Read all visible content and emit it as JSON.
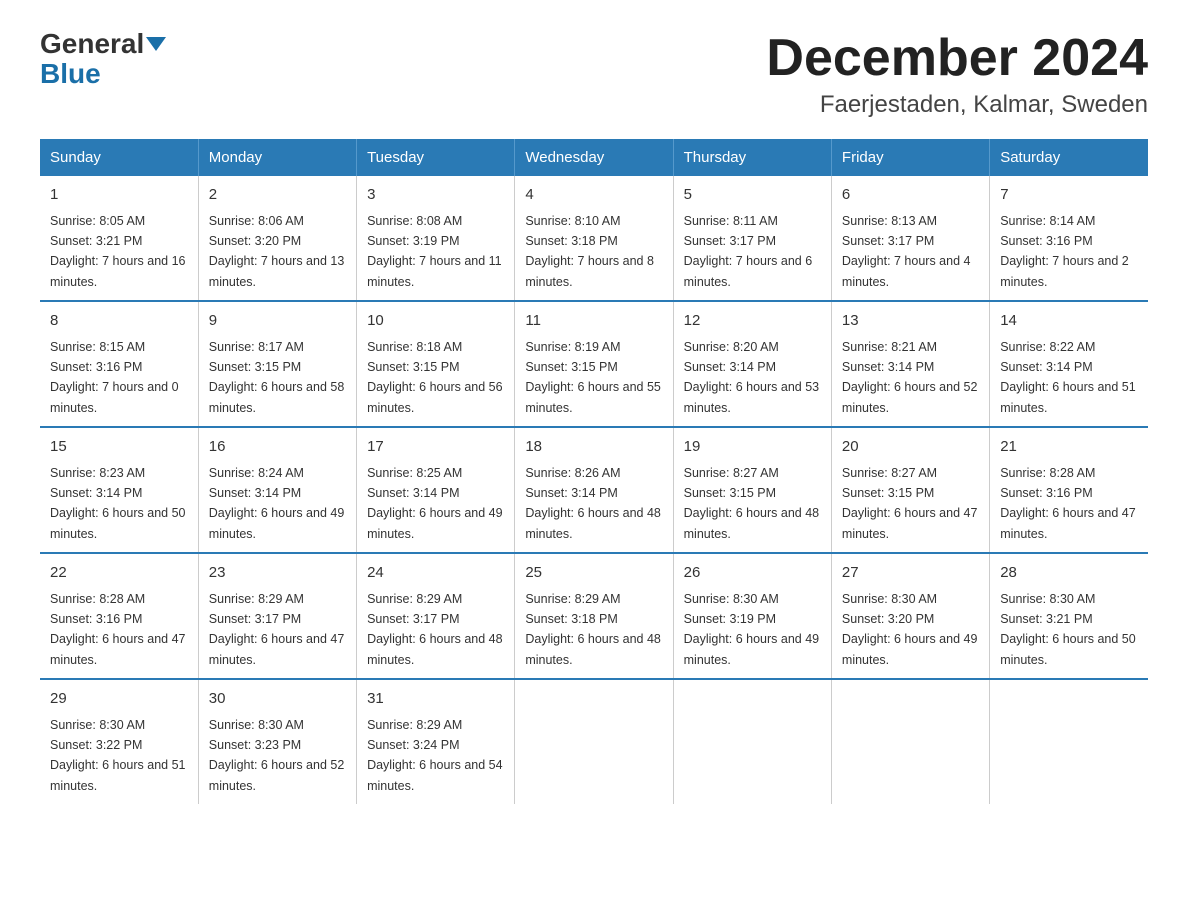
{
  "logo": {
    "top": "General",
    "bottom": "Blue"
  },
  "title": "December 2024",
  "subtitle": "Faerjestaden, Kalmar, Sweden",
  "headers": [
    "Sunday",
    "Monday",
    "Tuesday",
    "Wednesday",
    "Thursday",
    "Friday",
    "Saturday"
  ],
  "weeks": [
    [
      {
        "day": "1",
        "sunrise": "8:05 AM",
        "sunset": "3:21 PM",
        "daylight": "7 hours and 16 minutes."
      },
      {
        "day": "2",
        "sunrise": "8:06 AM",
        "sunset": "3:20 PM",
        "daylight": "7 hours and 13 minutes."
      },
      {
        "day": "3",
        "sunrise": "8:08 AM",
        "sunset": "3:19 PM",
        "daylight": "7 hours and 11 minutes."
      },
      {
        "day": "4",
        "sunrise": "8:10 AM",
        "sunset": "3:18 PM",
        "daylight": "7 hours and 8 minutes."
      },
      {
        "day": "5",
        "sunrise": "8:11 AM",
        "sunset": "3:17 PM",
        "daylight": "7 hours and 6 minutes."
      },
      {
        "day": "6",
        "sunrise": "8:13 AM",
        "sunset": "3:17 PM",
        "daylight": "7 hours and 4 minutes."
      },
      {
        "day": "7",
        "sunrise": "8:14 AM",
        "sunset": "3:16 PM",
        "daylight": "7 hours and 2 minutes."
      }
    ],
    [
      {
        "day": "8",
        "sunrise": "8:15 AM",
        "sunset": "3:16 PM",
        "daylight": "7 hours and 0 minutes."
      },
      {
        "day": "9",
        "sunrise": "8:17 AM",
        "sunset": "3:15 PM",
        "daylight": "6 hours and 58 minutes."
      },
      {
        "day": "10",
        "sunrise": "8:18 AM",
        "sunset": "3:15 PM",
        "daylight": "6 hours and 56 minutes."
      },
      {
        "day": "11",
        "sunrise": "8:19 AM",
        "sunset": "3:15 PM",
        "daylight": "6 hours and 55 minutes."
      },
      {
        "day": "12",
        "sunrise": "8:20 AM",
        "sunset": "3:14 PM",
        "daylight": "6 hours and 53 minutes."
      },
      {
        "day": "13",
        "sunrise": "8:21 AM",
        "sunset": "3:14 PM",
        "daylight": "6 hours and 52 minutes."
      },
      {
        "day": "14",
        "sunrise": "8:22 AM",
        "sunset": "3:14 PM",
        "daylight": "6 hours and 51 minutes."
      }
    ],
    [
      {
        "day": "15",
        "sunrise": "8:23 AM",
        "sunset": "3:14 PM",
        "daylight": "6 hours and 50 minutes."
      },
      {
        "day": "16",
        "sunrise": "8:24 AM",
        "sunset": "3:14 PM",
        "daylight": "6 hours and 49 minutes."
      },
      {
        "day": "17",
        "sunrise": "8:25 AM",
        "sunset": "3:14 PM",
        "daylight": "6 hours and 49 minutes."
      },
      {
        "day": "18",
        "sunrise": "8:26 AM",
        "sunset": "3:14 PM",
        "daylight": "6 hours and 48 minutes."
      },
      {
        "day": "19",
        "sunrise": "8:27 AM",
        "sunset": "3:15 PM",
        "daylight": "6 hours and 48 minutes."
      },
      {
        "day": "20",
        "sunrise": "8:27 AM",
        "sunset": "3:15 PM",
        "daylight": "6 hours and 47 minutes."
      },
      {
        "day": "21",
        "sunrise": "8:28 AM",
        "sunset": "3:16 PM",
        "daylight": "6 hours and 47 minutes."
      }
    ],
    [
      {
        "day": "22",
        "sunrise": "8:28 AM",
        "sunset": "3:16 PM",
        "daylight": "6 hours and 47 minutes."
      },
      {
        "day": "23",
        "sunrise": "8:29 AM",
        "sunset": "3:17 PM",
        "daylight": "6 hours and 47 minutes."
      },
      {
        "day": "24",
        "sunrise": "8:29 AM",
        "sunset": "3:17 PM",
        "daylight": "6 hours and 48 minutes."
      },
      {
        "day": "25",
        "sunrise": "8:29 AM",
        "sunset": "3:18 PM",
        "daylight": "6 hours and 48 minutes."
      },
      {
        "day": "26",
        "sunrise": "8:30 AM",
        "sunset": "3:19 PM",
        "daylight": "6 hours and 49 minutes."
      },
      {
        "day": "27",
        "sunrise": "8:30 AM",
        "sunset": "3:20 PM",
        "daylight": "6 hours and 49 minutes."
      },
      {
        "day": "28",
        "sunrise": "8:30 AM",
        "sunset": "3:21 PM",
        "daylight": "6 hours and 50 minutes."
      }
    ],
    [
      {
        "day": "29",
        "sunrise": "8:30 AM",
        "sunset": "3:22 PM",
        "daylight": "6 hours and 51 minutes."
      },
      {
        "day": "30",
        "sunrise": "8:30 AM",
        "sunset": "3:23 PM",
        "daylight": "6 hours and 52 minutes."
      },
      {
        "day": "31",
        "sunrise": "8:29 AM",
        "sunset": "3:24 PM",
        "daylight": "6 hours and 54 minutes."
      },
      null,
      null,
      null,
      null
    ]
  ]
}
